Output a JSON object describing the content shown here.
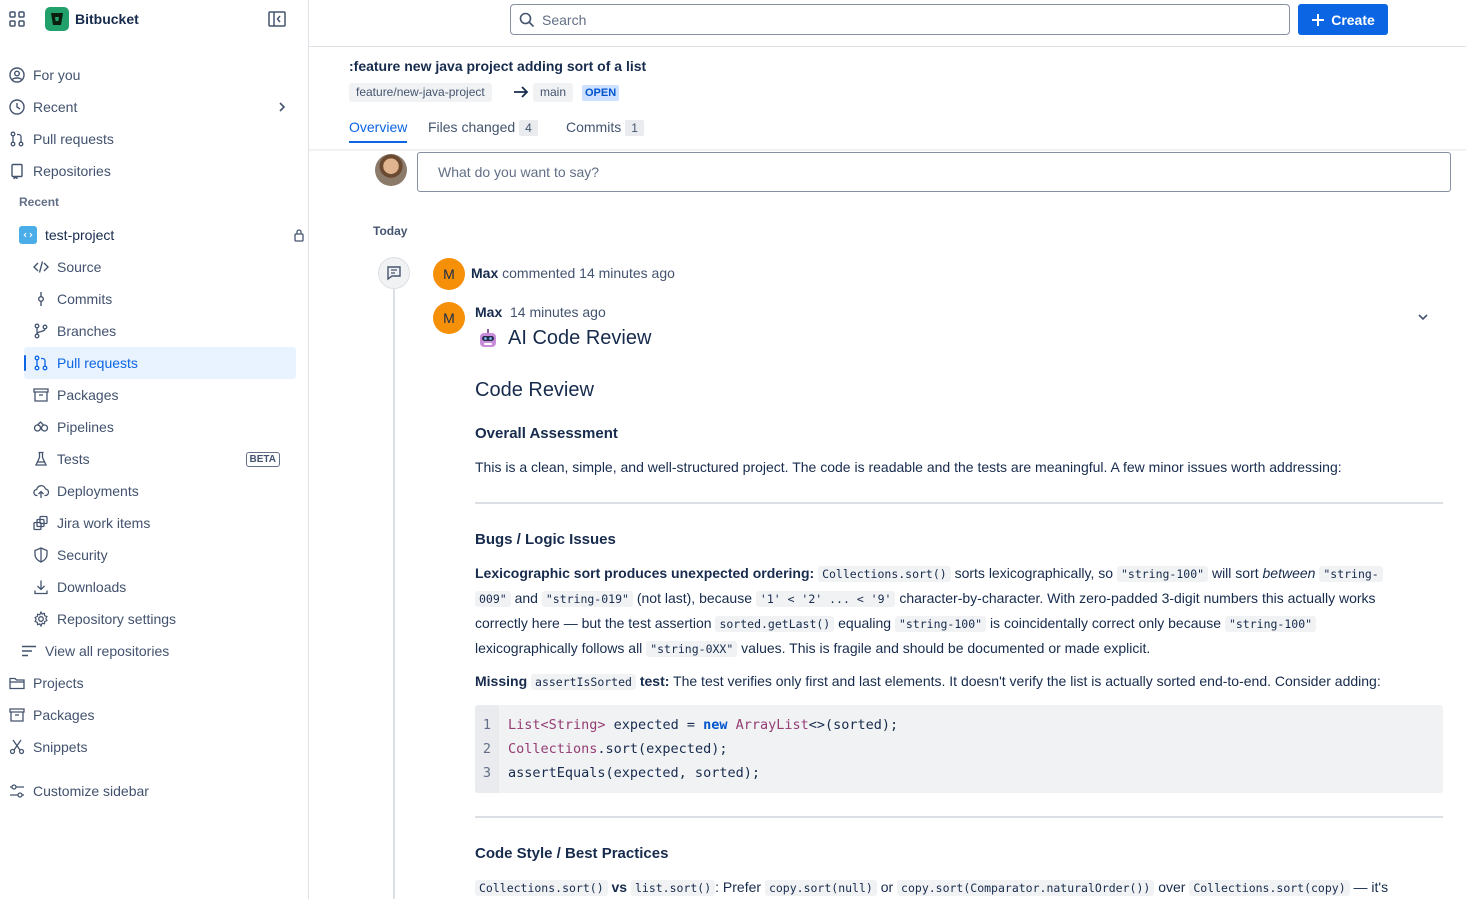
{
  "app": {
    "name": "Bitbucket"
  },
  "sidebar": {
    "top_items": [
      {
        "label": "For you"
      },
      {
        "label": "Recent"
      },
      {
        "label": "Pull requests"
      },
      {
        "label": "Repositories"
      }
    ],
    "recent_label": "Recent",
    "repo": {
      "name": "test-project"
    },
    "repo_items": [
      {
        "label": "Source"
      },
      {
        "label": "Commits"
      },
      {
        "label": "Branches"
      },
      {
        "label": "Pull requests"
      },
      {
        "label": "Packages"
      },
      {
        "label": "Pipelines"
      },
      {
        "label": "Tests",
        "badge": "BETA"
      },
      {
        "label": "Deployments"
      },
      {
        "label": "Jira work items"
      },
      {
        "label": "Security"
      },
      {
        "label": "Downloads"
      },
      {
        "label": "Repository settings"
      }
    ],
    "view_all": "View all repositories",
    "bottom_items": [
      {
        "label": "Projects"
      },
      {
        "label": "Packages"
      },
      {
        "label": "Snippets"
      }
    ],
    "customize": "Customize sidebar"
  },
  "header": {
    "search_placeholder": "Search",
    "create_label": "Create"
  },
  "pr": {
    "title": ":feature new java project adding sort of a list",
    "source_branch": "feature/new-java-project",
    "target_branch": "main",
    "status": "OPEN",
    "tabs": [
      {
        "label": "Overview"
      },
      {
        "label": "Files changed",
        "count": "4"
      },
      {
        "label": "Commits",
        "count": "1"
      }
    ]
  },
  "activity": {
    "comment_placeholder": "What do you want to say?",
    "date_group": "Today",
    "summary_author": "Max",
    "summary_text": "commented 14 minutes ago",
    "avatar_initial": "M",
    "comment": {
      "author": "Max",
      "time": "14 minutes ago",
      "ai_title": "AI Code Review",
      "heading": "Code Review",
      "overall_heading": "Overall Assessment",
      "overall_text": "This is a clean, simple, and well-structured project. The code is readable and the tests are meaningful. A few minor issues worth addressing:",
      "bugs_heading": "Bugs / Logic Issues",
      "bug1": {
        "bold": "Lexicographic sort produces unexpected ordering:",
        "code1": "Collections.sort()",
        "t1": "sorts lexicographically, so",
        "code2": "\"string-100\"",
        "t2": "will sort",
        "em": "between",
        "code3": "\"string-",
        "code3b": "009\"",
        "t3": "and",
        "code4": "\"string-019\"",
        "t4": "(not last), because",
        "code5": "'1' < '2' ... < '9'",
        "t5": "character-by-character. With zero-padded 3-digit numbers this actually works",
        "t6": "correctly here — but the test assertion",
        "code6": "sorted.getLast()",
        "t7": "equaling",
        "code7": "\"string-100\"",
        "t8": "is coincidentally correct only because",
        "code8": "\"string-100\"",
        "t9": "lexicographically follows all",
        "code9": "\"string-0XX\"",
        "t10": "values. This is fragile and should be documented or made explicit."
      },
      "bug2": {
        "bold1": "Missing",
        "code": "assertIsSorted",
        "bold2": "test:",
        "text": "The test verifies only first and last elements. It doesn't verify the list is actually sorted end-to-end. Consider adding:"
      },
      "code_lines": [
        {
          "n": "1",
          "text": "List<String> expected = new ArrayList<>(sorted);"
        },
        {
          "n": "2",
          "text": "Collections.sort(expected);"
        },
        {
          "n": "3",
          "text": "assertEquals(expected, sorted);"
        }
      ],
      "style_heading": "Code Style / Best Practices",
      "style": {
        "code1": "Collections.sort()",
        "vs": "vs",
        "code2": "list.sort()",
        "t1": ": Prefer",
        "code3": "copy.sort(null)",
        "or": "or",
        "code4": "copy.sort(Comparator.naturalOrder())",
        "over": "over",
        "code5": "Collections.sort(copy)",
        "tail": "— it's"
      }
    }
  },
  "colors": {
    "accent": "#0c66e4",
    "logo": "#22a06b",
    "avatar": "#f79009",
    "open_badge": "#cce0ff"
  }
}
